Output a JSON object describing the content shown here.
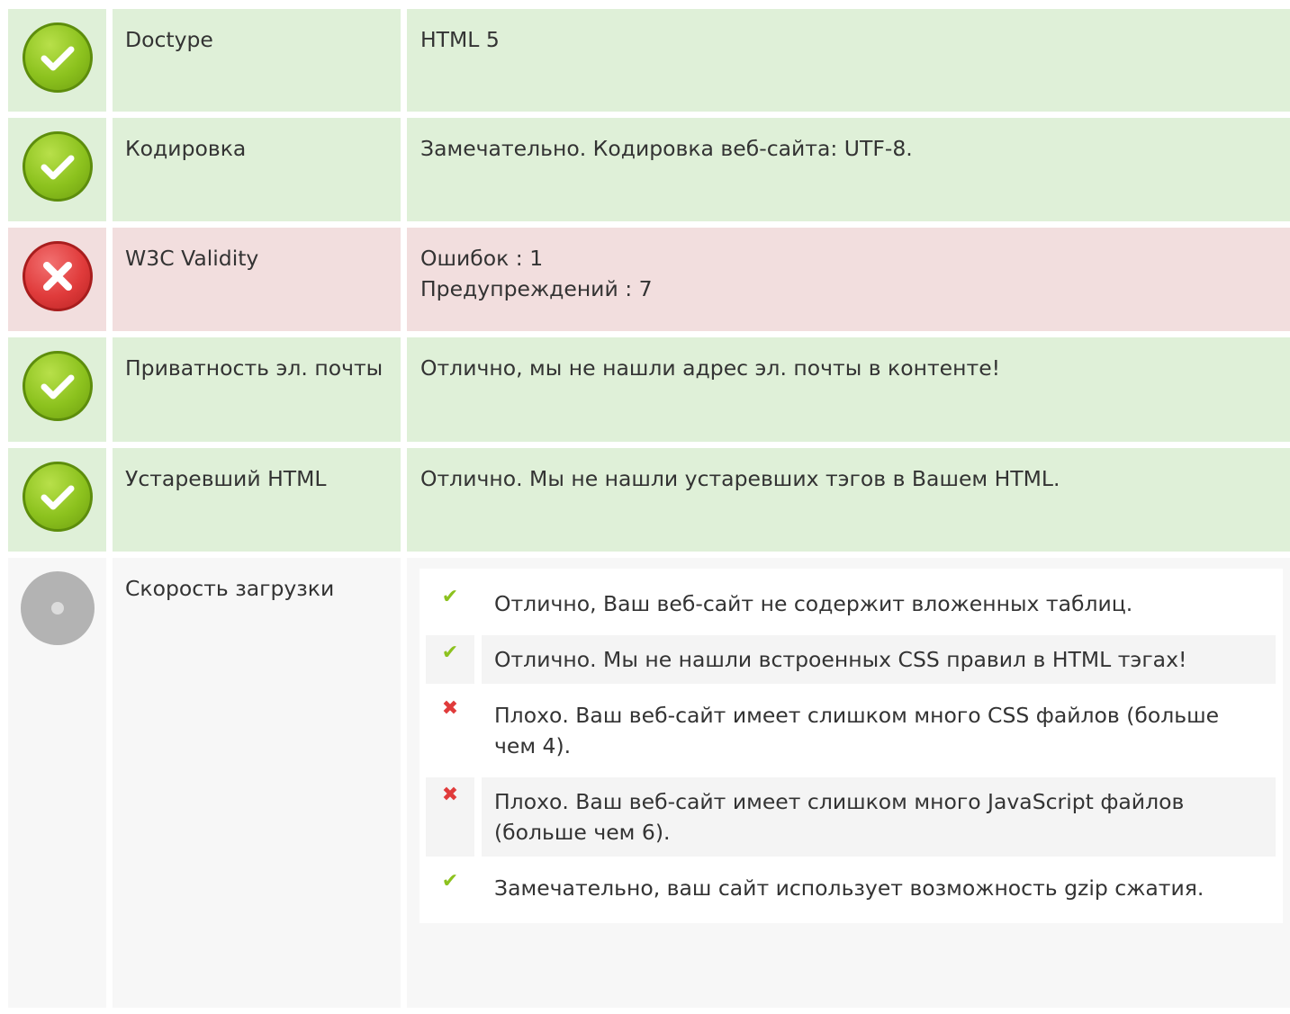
{
  "colors": {
    "pass_row": "#dff0d8",
    "fail_row": "#f2dede",
    "neutral_row": "#f7f7f7",
    "pass_icon": "#8cc21e",
    "fail_icon": "#e03b3b",
    "info_icon": "#b3b3b3"
  },
  "rows": [
    {
      "status": "pass",
      "icon": "check-circle-icon",
      "label": "Doctype",
      "value_lines": [
        "HTML 5"
      ]
    },
    {
      "status": "pass",
      "icon": "check-circle-icon",
      "label": "Кодировка",
      "value_lines": [
        "Замечательно. Кодировка веб-сайта: UTF-8."
      ]
    },
    {
      "status": "fail",
      "icon": "cross-circle-icon",
      "label": "W3C Validity",
      "value_lines": [
        "Ошибок : 1",
        "Предупреждений : 7"
      ]
    },
    {
      "status": "pass",
      "icon": "check-circle-icon",
      "label": "Приватность эл. почты",
      "value_lines": [
        "Отлично, мы не нашли адрес эл. почты в контенте!"
      ]
    },
    {
      "status": "pass",
      "icon": "check-circle-icon",
      "label": "Устаревший HTML",
      "value_lines": [
        "Отлично. Мы не нашли устаревших тэгов в Вашем HTML."
      ]
    },
    {
      "status": "info",
      "icon": "info-circle-icon",
      "label": "Скорость загрузки",
      "checks": [
        {
          "result": "ok",
          "icon": "checkmark-icon",
          "text": "Отлично, Ваш веб-сайт не содержит вложенных таблиц."
        },
        {
          "result": "ok",
          "icon": "checkmark-icon",
          "text": "Отлично. Мы не нашли встроенных CSS правил в HTML тэгах!"
        },
        {
          "result": "bad",
          "icon": "cross-mark-icon",
          "text": "Плохо. Ваш веб-сайт имеет слишком много CSS файлов (больше чем 4)."
        },
        {
          "result": "bad",
          "icon": "cross-mark-icon",
          "text": "Плохо. Ваш веб-сайт имеет слишком много JavaScript файлов (больше чем 6)."
        },
        {
          "result": "ok",
          "icon": "checkmark-icon",
          "text": "Замечательно, ваш сайт использует возможность gzip сжатия."
        }
      ]
    }
  ]
}
